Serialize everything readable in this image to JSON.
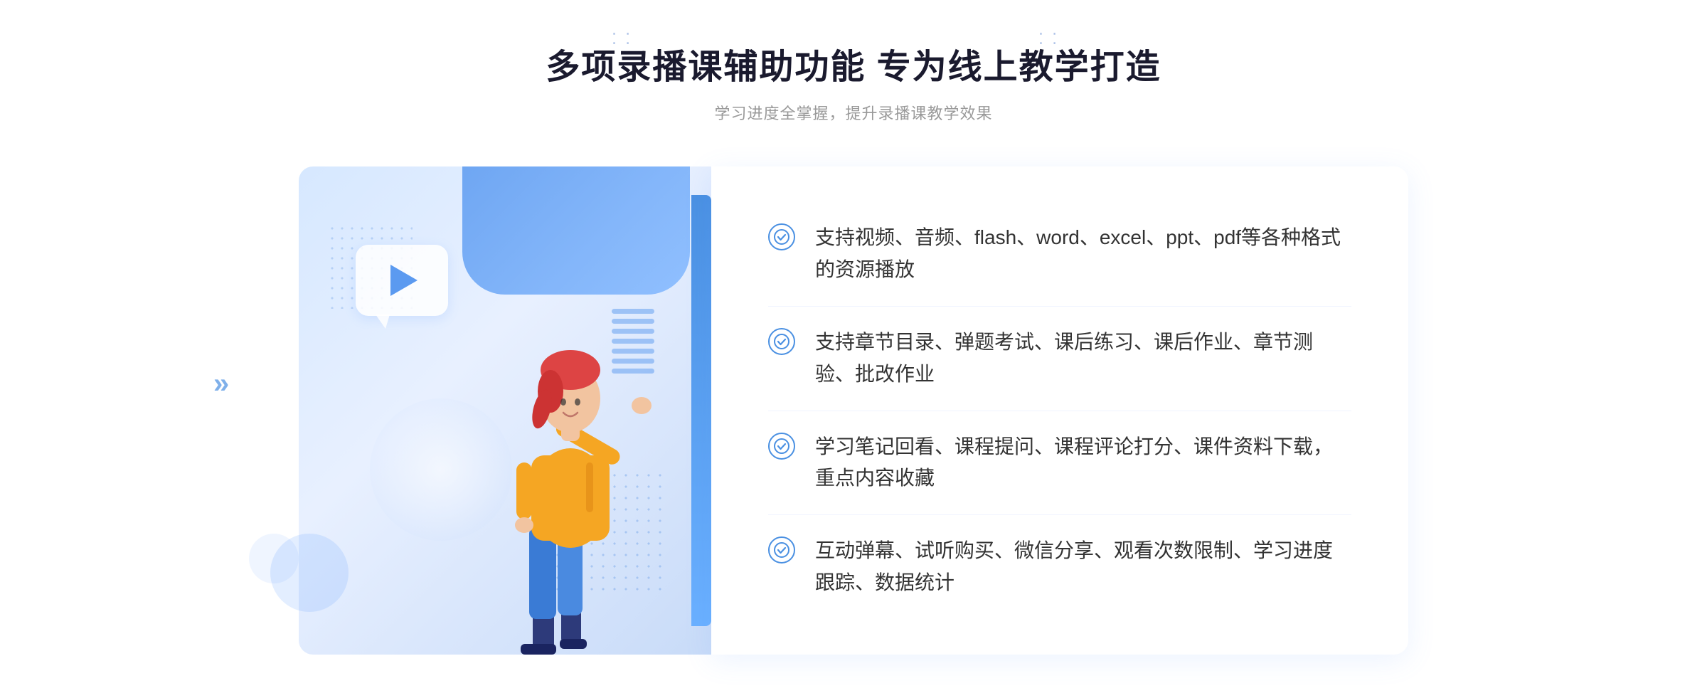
{
  "header": {
    "main_title": "多项录播课辅助功能 专为线上教学打造",
    "sub_title": "学习进度全掌握，提升录播课教学效果"
  },
  "features": [
    {
      "id": "feature-1",
      "text": "支持视频、音频、flash、word、excel、ppt、pdf等各种格式的资源播放"
    },
    {
      "id": "feature-2",
      "text": "支持章节目录、弹题考试、课后练习、课后作业、章节测验、批改作业"
    },
    {
      "id": "feature-3",
      "text": "学习笔记回看、课程提问、课程评论打分、课件资料下载，重点内容收藏"
    },
    {
      "id": "feature-4",
      "text": "互动弹幕、试听购买、微信分享、观看次数限制、学习进度跟踪、数据统计"
    }
  ],
  "deco": {
    "dots_left": "⁚⁚",
    "dots_right": "⁚⁚",
    "chevron": "»"
  },
  "colors": {
    "accent": "#4a90e2",
    "title": "#1a1a2e",
    "subtitle": "#999999",
    "text": "#333333",
    "check": "#4a90e2"
  }
}
